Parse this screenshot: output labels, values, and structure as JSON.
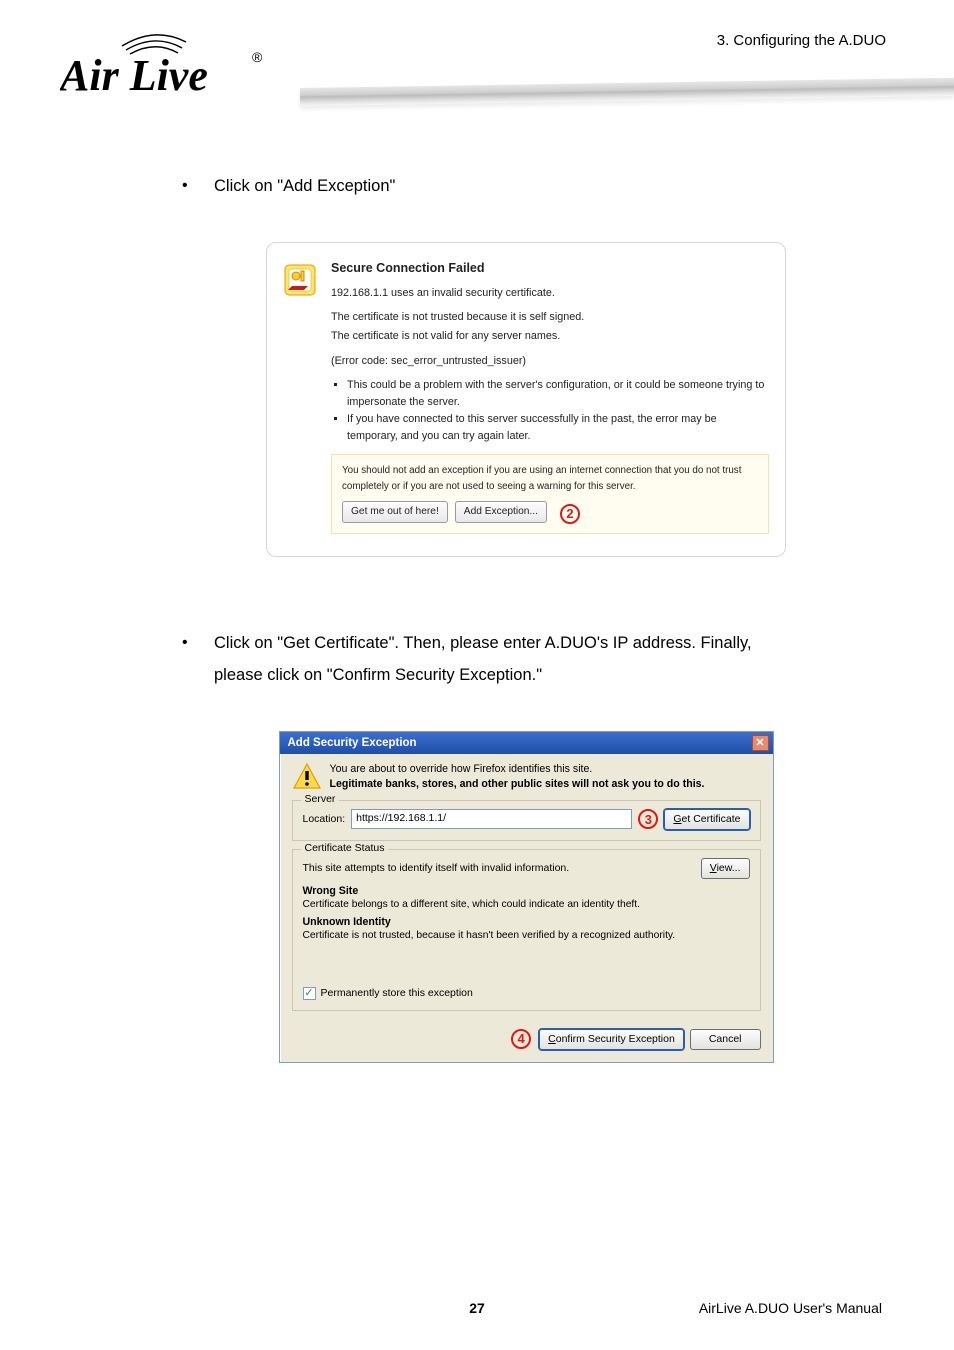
{
  "header": {
    "chapter": "3.  Configuring  the  A.DUO",
    "logo_main": "Air Live",
    "logo_reg": "®"
  },
  "bullets": {
    "b1": "Click on \"Add Exception\"",
    "b2a": "Click on \"Get Certificate\". Then, please enter A.DUO's IP address. Finally,",
    "b2b": "please click on \"Confirm Security Exception.\""
  },
  "dlg1": {
    "title": "Secure Connection Failed",
    "line1": "192.168.1.1 uses an invalid security certificate.",
    "line2": "The certificate is not trusted because it is self signed.",
    "line3": "The certificate is not valid for any server names.",
    "line4": "(Error code: sec_error_untrusted_issuer)",
    "li1": "This could be a problem with the server's configuration, or it could be someone trying to impersonate the server.",
    "li2": "If you have connected to this server successfully in the past, the error may be temporary, and you can try again later.",
    "warn": "You should not add an exception if you are using an internet connection that you do not trust completely or if you are not used to seeing a warning for this server.",
    "btn_out": "Get me out of here!",
    "btn_add": "Add Exception...",
    "anno": "2"
  },
  "dlg2": {
    "title": "Add Security Exception",
    "intro1": "You are about to override how Firefox identifies this site.",
    "intro2": "Legitimate banks, stores, and other public sites will not ask you to do this.",
    "server_legend": "Server",
    "location_label": "Location:",
    "location_value": "https://192.168.1.1/",
    "get_cert": "Get Certificate",
    "anno3": "3",
    "cs_legend": "Certificate Status",
    "cs_text": "This site attempts to identify itself with invalid information.",
    "view_btn": "View...",
    "wrong_site": "Wrong Site",
    "wrong_site_text": "Certificate belongs to a different site, which could indicate an identity theft.",
    "unknown": "Unknown Identity",
    "unknown_text": "Certificate is not trusted, because it hasn't been verified by a recognized authority.",
    "perm_store": "Permanently store this exception",
    "confirm": "Confirm Security Exception",
    "cancel": "Cancel",
    "anno4": "4"
  },
  "footer": {
    "page": "27",
    "right": "AirLive A.DUO User's Manual"
  }
}
